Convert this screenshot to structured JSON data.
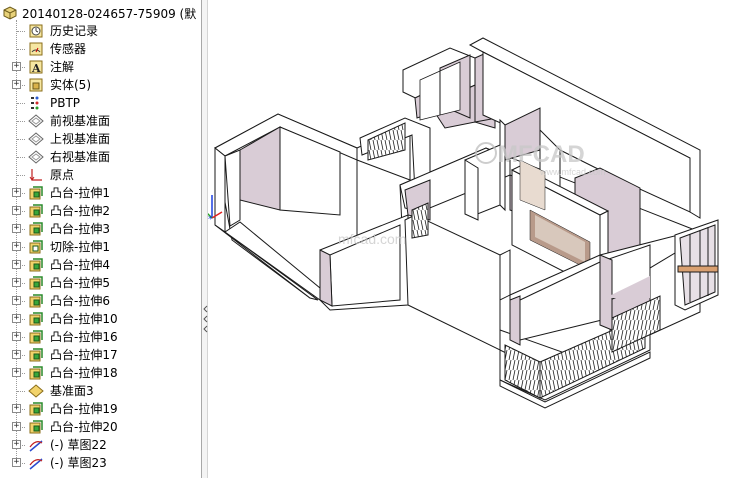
{
  "feature_tree": {
    "root_label": "20140128-024657-75909  (默",
    "items": [
      {
        "label": "历史记录",
        "icon": "history-icon",
        "expandable": false
      },
      {
        "label": "传感器",
        "icon": "sensor-icon",
        "expandable": false
      },
      {
        "label": "注解",
        "icon": "annotation-icon",
        "expandable": true
      },
      {
        "label": "实体(5)",
        "icon": "solid-bodies-icon",
        "expandable": true
      },
      {
        "label": "PBTP",
        "icon": "material-icon",
        "expandable": false
      },
      {
        "label": "前视基准面",
        "icon": "plane-icon",
        "expandable": false
      },
      {
        "label": "上视基准面",
        "icon": "plane-icon",
        "expandable": false
      },
      {
        "label": "右视基准面",
        "icon": "plane-icon",
        "expandable": false
      },
      {
        "label": "原点",
        "icon": "origin-icon",
        "expandable": false
      },
      {
        "label": "凸台-拉伸1",
        "icon": "boss-extrude-icon",
        "expandable": true
      },
      {
        "label": "凸台-拉伸2",
        "icon": "boss-extrude-icon",
        "expandable": true
      },
      {
        "label": "凸台-拉伸3",
        "icon": "boss-extrude-icon",
        "expandable": true
      },
      {
        "label": "切除-拉伸1",
        "icon": "cut-extrude-icon",
        "expandable": true
      },
      {
        "label": "凸台-拉伸4",
        "icon": "boss-extrude-icon",
        "expandable": true
      },
      {
        "label": "凸台-拉伸5",
        "icon": "boss-extrude-icon",
        "expandable": true
      },
      {
        "label": "凸台-拉伸6",
        "icon": "boss-extrude-icon",
        "expandable": true
      },
      {
        "label": "凸台-拉伸10",
        "icon": "boss-extrude-icon",
        "expandable": true
      },
      {
        "label": "凸台-拉伸16",
        "icon": "boss-extrude-icon",
        "expandable": true
      },
      {
        "label": "凸台-拉伸17",
        "icon": "boss-extrude-icon",
        "expandable": true
      },
      {
        "label": "凸台-拉伸18",
        "icon": "boss-extrude-icon",
        "expandable": true
      },
      {
        "label": "基准面3",
        "icon": "plane-yellow-icon",
        "expandable": false
      },
      {
        "label": "凸台-拉伸19",
        "icon": "boss-extrude-icon",
        "expandable": true
      },
      {
        "label": "凸台-拉伸20",
        "icon": "boss-extrude-icon",
        "expandable": true
      },
      {
        "label": "(-) 草图22",
        "icon": "sketch-icon",
        "expandable": true
      },
      {
        "label": "(-) 草图23",
        "icon": "sketch-icon",
        "expandable": true
      }
    ]
  },
  "viewport": {
    "watermark_logo": "MFCAD",
    "watermark_sub": "www.mfcad.com",
    "watermark_center": "mfcad.com",
    "colors": {
      "wall_top": "#ffffff",
      "wall_inner": "#d9ccd6",
      "wall_shadow": "#bfb3bd",
      "outline": "#1a1a1a",
      "railing": "#2a2a2a"
    }
  }
}
